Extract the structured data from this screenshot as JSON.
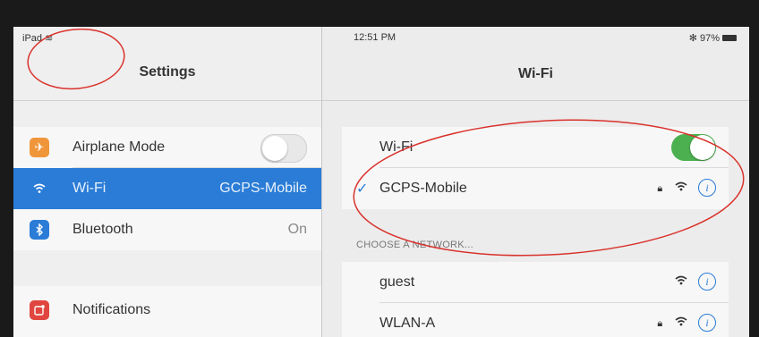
{
  "status_bar": {
    "device": "iPad",
    "time": "12:51 PM",
    "battery": "97%"
  },
  "sidebar": {
    "title": "Settings",
    "items": [
      {
        "label": "Airplane Mode",
        "value": "",
        "icon": "airplane-icon",
        "icon_glyph": "✈",
        "icon_color": "#f0963a",
        "toggle": "off"
      },
      {
        "label": "Wi-Fi",
        "value": "GCPS-Mobile",
        "icon": "wifi-icon",
        "icon_glyph": "≋",
        "icon_color": "#2a7cd6",
        "selected": true
      },
      {
        "label": "Bluetooth",
        "value": "On",
        "icon": "bluetooth-icon",
        "icon_glyph": "ʙ",
        "icon_color": "#2a7cd6"
      },
      {
        "label": "Notifications",
        "value": "",
        "icon": "notifications-icon",
        "icon_glyph": "▣",
        "icon_color": "#e0463f"
      }
    ]
  },
  "main": {
    "title": "Wi-Fi",
    "wifi_row": {
      "label": "Wi-Fi",
      "toggle": "on"
    },
    "connected": {
      "label": "GCPS-Mobile",
      "locked": true
    },
    "section_header": "CHOOSE A NETWORK...",
    "networks": [
      {
        "label": "guest",
        "locked": false
      },
      {
        "label": "WLAN-A",
        "locked": true
      }
    ]
  },
  "colors": {
    "accent": "#2a7cd6",
    "toggle_on": "#4caf50",
    "annotation": "#d9322c"
  }
}
